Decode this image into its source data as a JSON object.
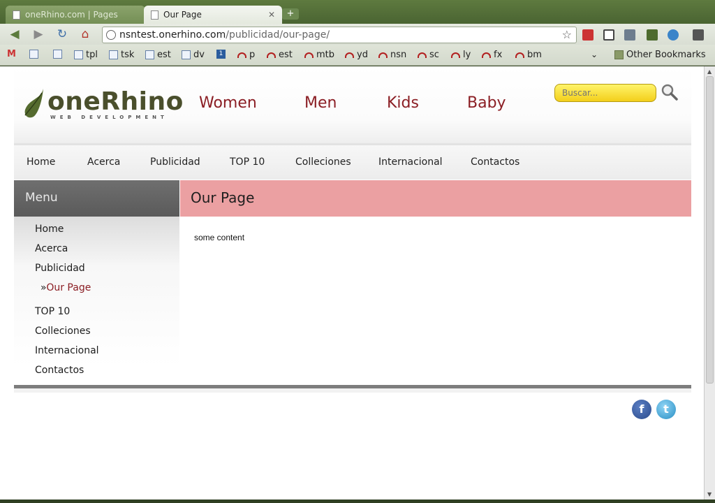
{
  "browser": {
    "tabs": [
      {
        "label": "oneRhino.com | Pages",
        "active": false
      },
      {
        "label": "Our Page",
        "active": true
      }
    ],
    "new_tab": "+",
    "url_host": "nsntest.onerhino.com",
    "url_path": "/publicidad/our-page/",
    "bookmarks": [
      {
        "label": "",
        "icon": "gmail-icon"
      },
      {
        "label": "",
        "icon": "st-icon"
      },
      {
        "label": "",
        "icon": "page-icon"
      },
      {
        "label": "tpl",
        "icon": "page-icon"
      },
      {
        "label": "tsk",
        "icon": "page-icon"
      },
      {
        "label": "est",
        "icon": "page-icon"
      },
      {
        "label": "dv",
        "icon": "page-icon"
      },
      {
        "label": "",
        "icon": "one-icon"
      },
      {
        "label": "p",
        "icon": "arc-icon"
      },
      {
        "label": "est",
        "icon": "arc-icon"
      },
      {
        "label": "mtb",
        "icon": "arc-icon"
      },
      {
        "label": "yd",
        "icon": "arc-icon"
      },
      {
        "label": "nsn",
        "icon": "arc-icon"
      },
      {
        "label": "sc",
        "icon": "arc-icon"
      },
      {
        "label": "ly",
        "icon": "arc-icon"
      },
      {
        "label": "fx",
        "icon": "arc-icon"
      },
      {
        "label": "bm",
        "icon": "arc-icon"
      }
    ],
    "other_bookmarks": "Other Bookmarks"
  },
  "site": {
    "logo_text": "oneRhino",
    "logo_sub": "WEB DEVELOPMENT",
    "categories": [
      "Women",
      "Men",
      "Kids",
      "Baby"
    ],
    "search_placeholder": "Buscar...",
    "nav": [
      "Home",
      "Acerca",
      "Publicidad",
      "TOP 10",
      "Colleciones",
      "Internacional",
      "Contactos"
    ],
    "sidebar": {
      "title": "Menu",
      "items": [
        "Home",
        "Acerca",
        "Publicidad"
      ],
      "sub_prefix": "»",
      "sub_item": "Our Page",
      "items_after": [
        "TOP 10",
        "Colleciones",
        "Internacional",
        "Contactos"
      ]
    },
    "page_title": "Our Page",
    "content": "some content",
    "colors": {
      "accent": "#8b1e24",
      "title_bar": "#eba0a2",
      "search": "#f3cf1b"
    }
  }
}
